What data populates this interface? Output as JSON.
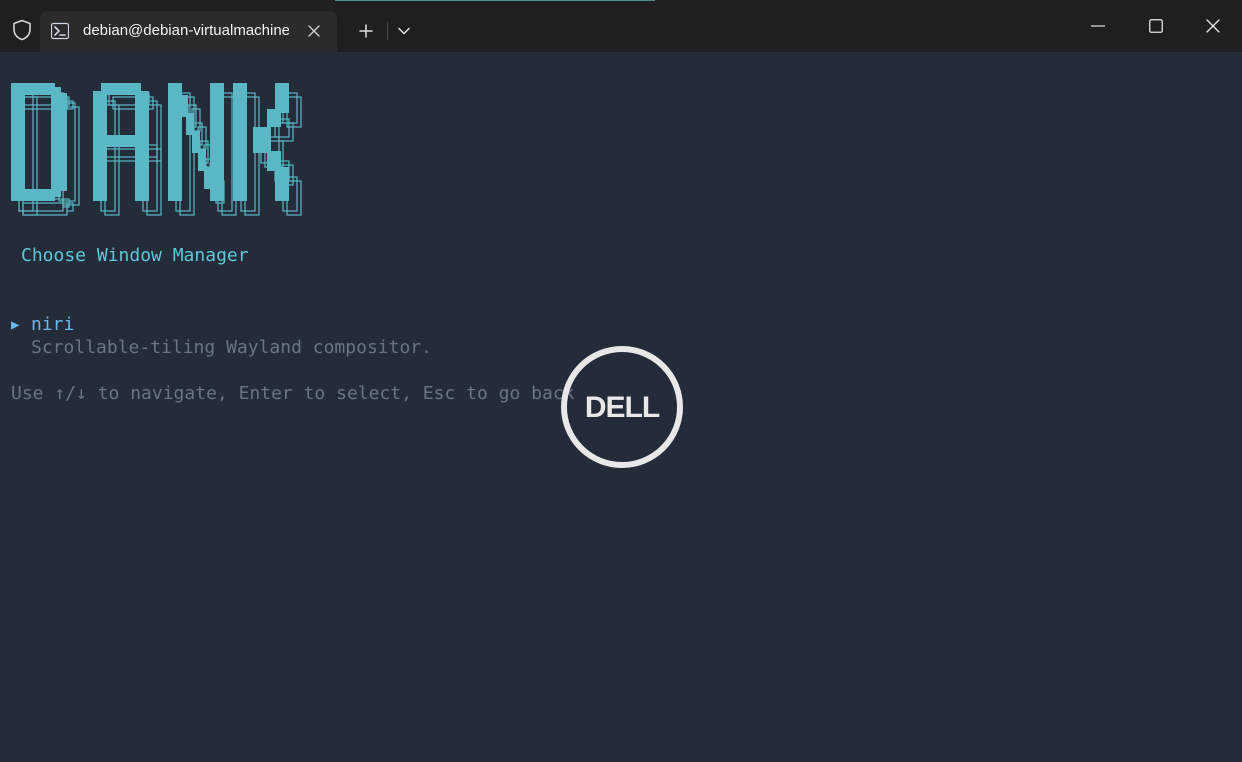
{
  "titlebar": {
    "tab_title": "debian@debian-virtualmachine",
    "icons": {
      "security": "shield-icon",
      "tab": "powershell-icon",
      "close_tab": "close-icon",
      "new_tab": "plus-icon",
      "dropdown": "chevron-down-icon",
      "minimize": "minimize-icon",
      "maximize": "maximize-icon",
      "close_window": "close-icon"
    }
  },
  "terminal": {
    "banner_text": "DANK",
    "heading": "Choose Window Manager",
    "options": [
      {
        "marker": "▶",
        "name": "niri",
        "description": "Scrollable-tiling Wayland compositor."
      }
    ],
    "help": "Use ↑/↓ to navigate, Enter to select, Esc to go back"
  },
  "overlay": {
    "logo_text": "DELL"
  },
  "colors": {
    "background": "#232c38",
    "titlebar": "#1f1f1f",
    "banner": "#5ab8c6",
    "heading": "#5fc8d8",
    "selected": "#6ab8ee",
    "muted": "#6b7582",
    "logo": "#e8e8e8"
  }
}
